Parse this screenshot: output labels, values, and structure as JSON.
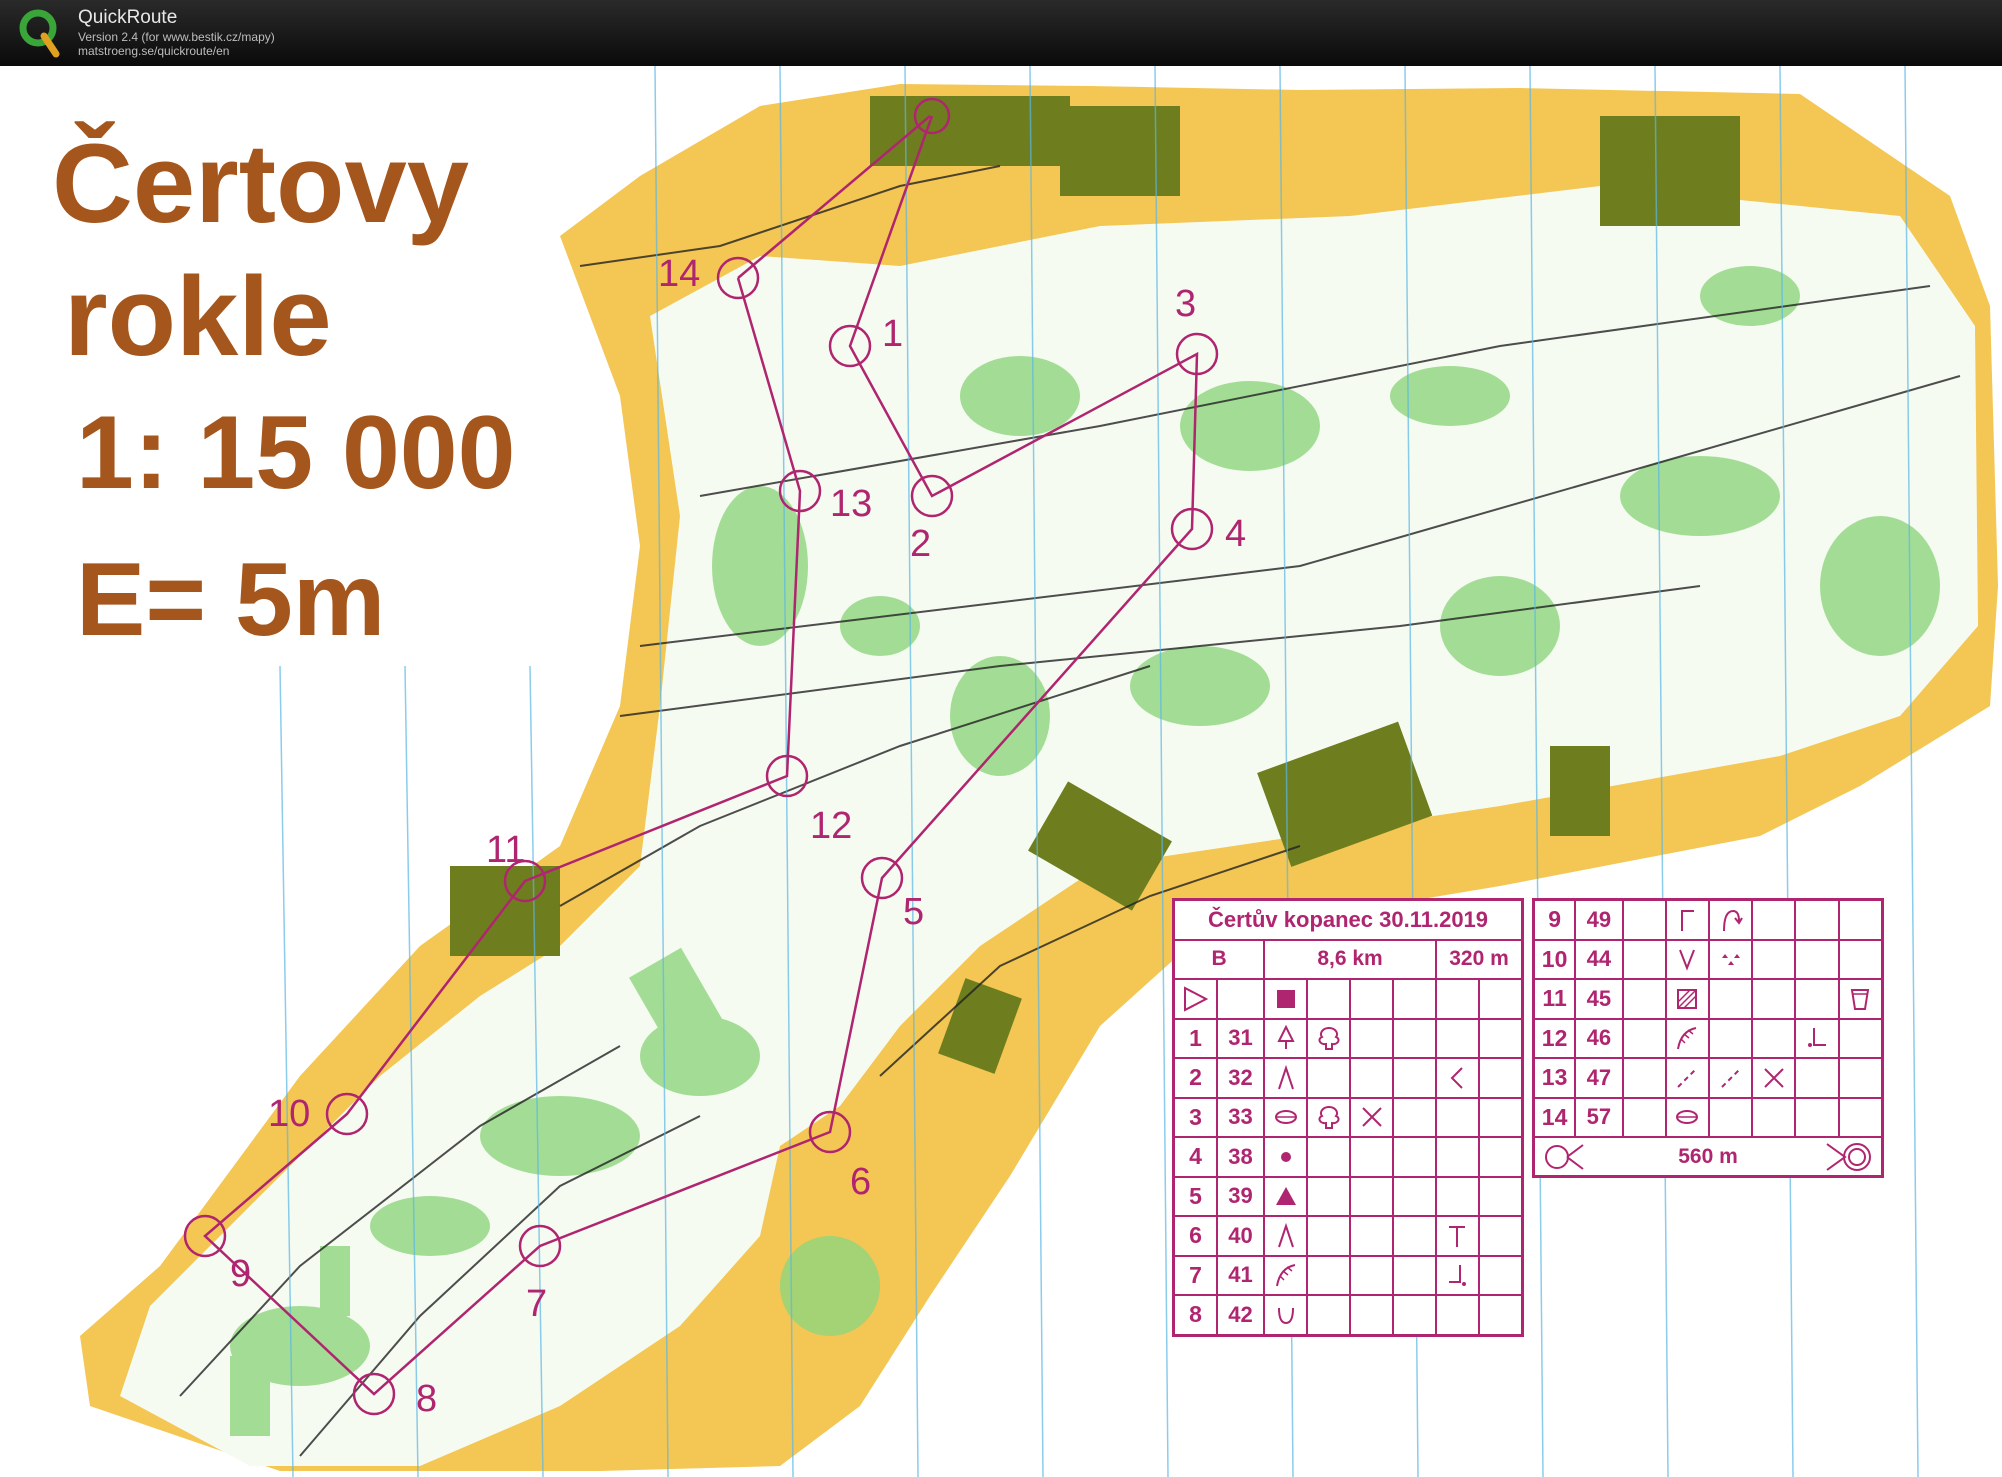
{
  "app": {
    "name": "QuickRoute",
    "version": "Version 2.4  (for www.bestik.cz/mapy)",
    "url": "matstroeng.se/quickroute/en"
  },
  "map": {
    "title_line1": "Čertovy",
    "title_line2": "rokle",
    "scale": "1: 15 000",
    "contour": "E= 5m"
  },
  "course": {
    "event": "Čertův kopanec 30.11.2019",
    "class": "B",
    "length": "8,6 km",
    "climb": "320 m",
    "finish_distance": "560 m",
    "controls": [
      {
        "label": "1",
        "code": "31"
      },
      {
        "label": "2",
        "code": "32"
      },
      {
        "label": "3",
        "code": "33"
      },
      {
        "label": "4",
        "code": "38"
      },
      {
        "label": "5",
        "code": "39"
      },
      {
        "label": "6",
        "code": "40"
      },
      {
        "label": "7",
        "code": "41"
      },
      {
        "label": "8",
        "code": "42"
      },
      {
        "label": "9",
        "code": "49"
      },
      {
        "label": "10",
        "code": "44"
      },
      {
        "label": "11",
        "code": "45"
      },
      {
        "label": "12",
        "code": "46"
      },
      {
        "label": "13",
        "code": "47"
      },
      {
        "label": "14",
        "code": "57"
      }
    ]
  },
  "colors": {
    "course": "#b0256f",
    "title": "#a5561c",
    "open_land": "#f4c653",
    "forest_green": "#7dcf6e",
    "settlement": "#6e7e1e"
  }
}
